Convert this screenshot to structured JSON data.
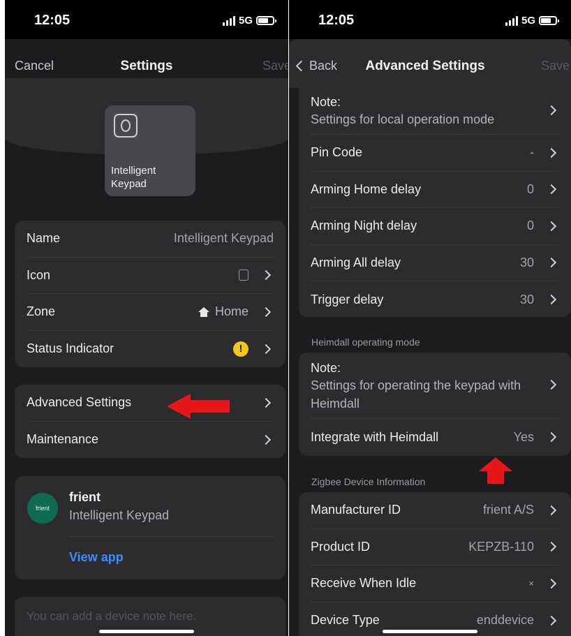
{
  "status_bar": {
    "time": "12:05",
    "network": "5G"
  },
  "left": {
    "nav": {
      "cancel": "Cancel",
      "title": "Settings",
      "save": "Save"
    },
    "device_tile": {
      "label": "Intelligent Keypad"
    },
    "general": [
      {
        "label": "Name",
        "value": "Intelligent Keypad"
      },
      {
        "label": "Icon",
        "value": ""
      },
      {
        "label": "Zone",
        "value": "Home"
      },
      {
        "label": "Status Indicator",
        "value": "!"
      }
    ],
    "more": [
      {
        "label": "Advanced Settings"
      },
      {
        "label": "Maintenance"
      }
    ],
    "app_card": {
      "brand": "frient",
      "product": "Intelligent Keypad",
      "link": "View app",
      "logo_text": "frient"
    },
    "note_placeholder": "You can add a device note here."
  },
  "right": {
    "nav": {
      "back": "Back",
      "title": "Advanced Settings",
      "save": "Save"
    },
    "local": {
      "note_title": "Note:",
      "note_text": "Settings for local operation mode",
      "rows": [
        {
          "label": "Pin Code",
          "value": "-"
        },
        {
          "label": "Arming Home delay",
          "value": "0"
        },
        {
          "label": "Arming Night delay",
          "value": "0"
        },
        {
          "label": "Arming All delay",
          "value": "30"
        },
        {
          "label": "Trigger delay",
          "value": "30"
        }
      ]
    },
    "heimdall": {
      "section": "Heimdall operating mode",
      "note_title": "Note:",
      "note_text": "Settings for operating the keypad with Heimdall",
      "integrate_label": "Integrate with Heimdall",
      "integrate_value": "Yes"
    },
    "zigbee": {
      "section": "Zigbee Device Information",
      "rows": [
        {
          "label": "Manufacturer ID",
          "value": "frient A/S"
        },
        {
          "label": "Product ID",
          "value": "KEPZB-110"
        },
        {
          "label": "Receive When Idle",
          "value": "×"
        },
        {
          "label": "Device Type",
          "value": "enddevice"
        }
      ]
    }
  },
  "colors": {
    "background": "#1c1c1e",
    "card": "#2c2c2e",
    "link": "#3b8cff",
    "annotation_arrow": "#e8151b",
    "brand_green": "#0f6b4f",
    "warning": "#f5c518"
  },
  "icons": [
    "signal-icon",
    "battery-icon",
    "keypad-icon",
    "home-icon",
    "warning-icon",
    "chevron-right-icon",
    "chevron-left-icon",
    "red-arrow-left",
    "red-arrow-up"
  ]
}
